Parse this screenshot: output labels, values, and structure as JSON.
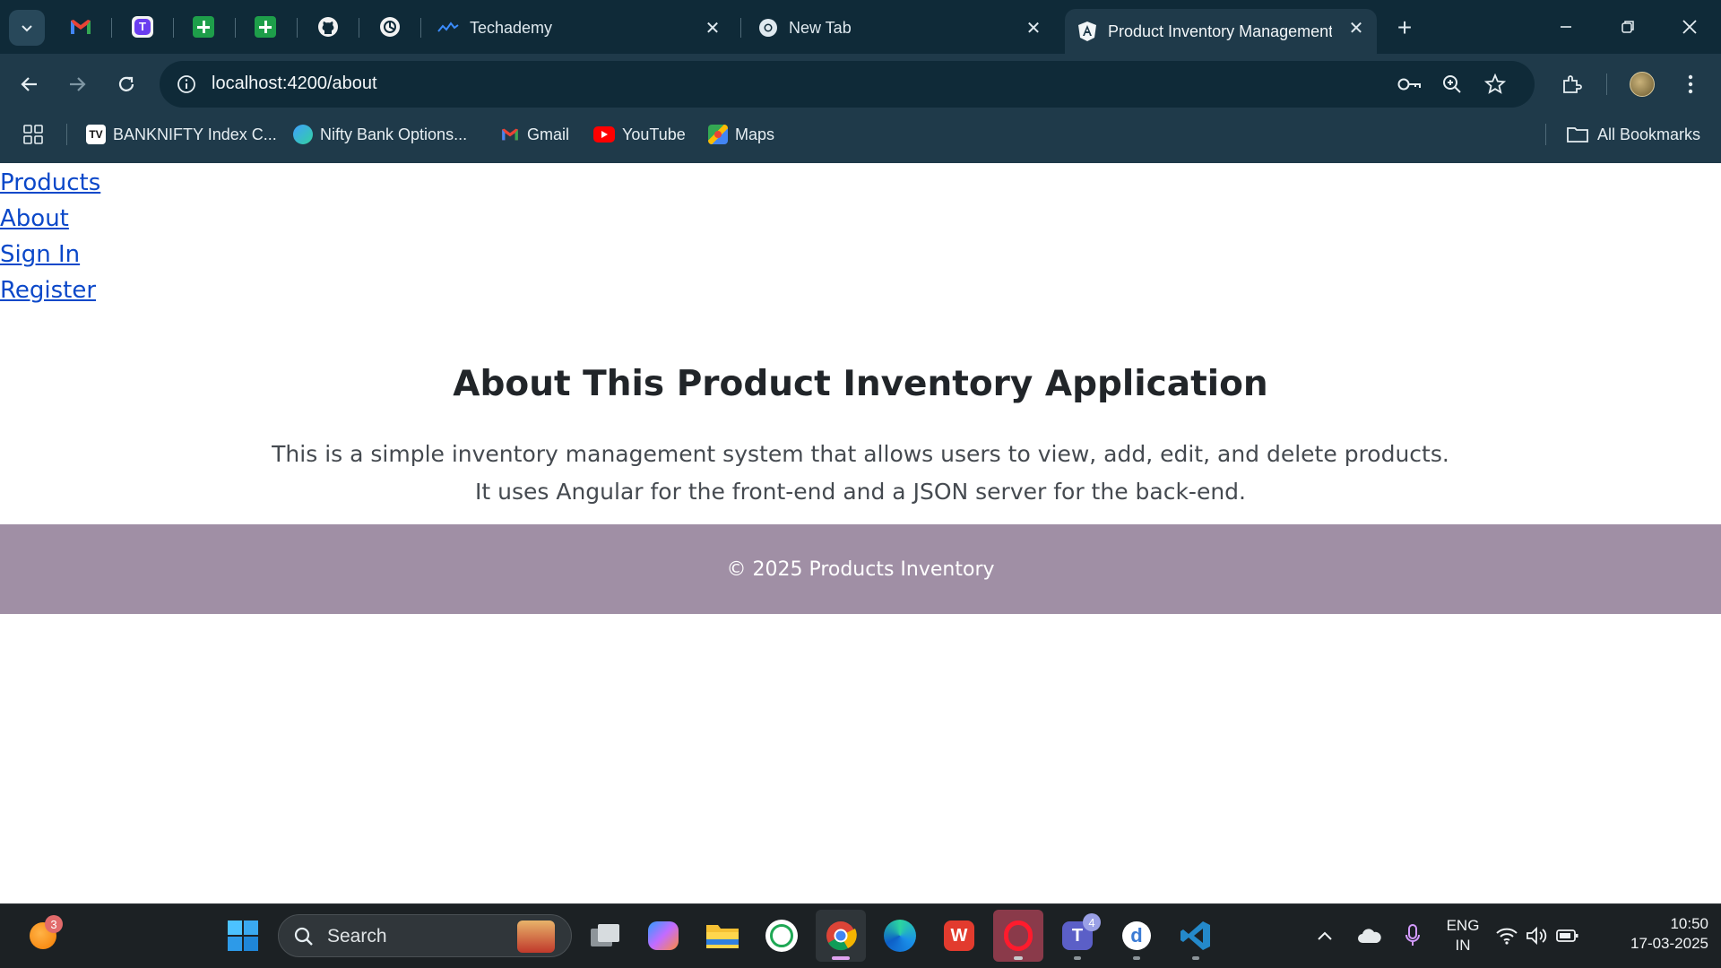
{
  "browser": {
    "tabs": [
      {
        "title": "Techademy",
        "active": false
      },
      {
        "title": "New Tab",
        "active": false
      },
      {
        "title": "Product Inventory Management",
        "active": true
      }
    ],
    "url": "localhost:4200/about",
    "bookmarks": [
      {
        "label": "BANKNIFTY Index C...",
        "icon": "tradingview-icon"
      },
      {
        "label": "Nifty Bank Options...",
        "icon": "sensibull-icon"
      },
      {
        "label": "Gmail",
        "icon": "gmail-icon"
      },
      {
        "label": "YouTube",
        "icon": "youtube-icon"
      },
      {
        "label": "Maps",
        "icon": "maps-icon"
      }
    ],
    "all_bookmarks_label": "All Bookmarks"
  },
  "page": {
    "nav": [
      "Products",
      "About",
      "Sign In",
      "Register"
    ],
    "title": "About This Product Inventory Application",
    "description": "This is a simple inventory management system that allows users to view, add, edit, and delete products. It uses Angular for the front-end and a JSON server for the back-end.",
    "footer": "© 2025 Products Inventory",
    "colors": {
      "link": "#0b48c9",
      "footer_bg": "#a08fa5"
    }
  },
  "taskbar": {
    "search_label": "Search",
    "notification_badge": "3",
    "teams_badge": "4",
    "language_line1": "ENG",
    "language_line2": "IN",
    "time": "10:50",
    "date": "17-03-2025"
  }
}
